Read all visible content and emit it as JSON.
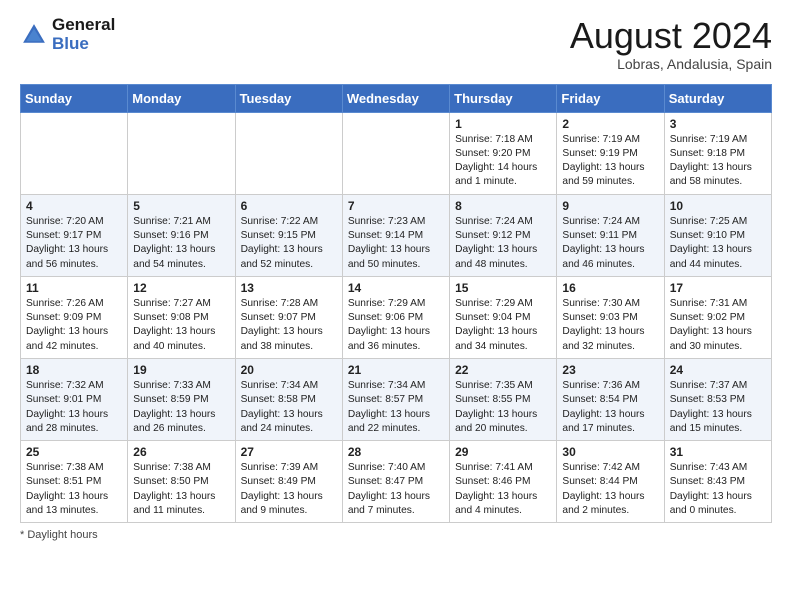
{
  "header": {
    "logo_line1": "General",
    "logo_line2": "Blue",
    "month_year": "August 2024",
    "location": "Lobras, Andalusia, Spain"
  },
  "days_of_week": [
    "Sunday",
    "Monday",
    "Tuesday",
    "Wednesday",
    "Thursday",
    "Friday",
    "Saturday"
  ],
  "weeks": [
    [
      {
        "day": "",
        "info": ""
      },
      {
        "day": "",
        "info": ""
      },
      {
        "day": "",
        "info": ""
      },
      {
        "day": "",
        "info": ""
      },
      {
        "day": "1",
        "info": "Sunrise: 7:18 AM\nSunset: 9:20 PM\nDaylight: 14 hours\nand 1 minute."
      },
      {
        "day": "2",
        "info": "Sunrise: 7:19 AM\nSunset: 9:19 PM\nDaylight: 13 hours\nand 59 minutes."
      },
      {
        "day": "3",
        "info": "Sunrise: 7:19 AM\nSunset: 9:18 PM\nDaylight: 13 hours\nand 58 minutes."
      }
    ],
    [
      {
        "day": "4",
        "info": "Sunrise: 7:20 AM\nSunset: 9:17 PM\nDaylight: 13 hours\nand 56 minutes."
      },
      {
        "day": "5",
        "info": "Sunrise: 7:21 AM\nSunset: 9:16 PM\nDaylight: 13 hours\nand 54 minutes."
      },
      {
        "day": "6",
        "info": "Sunrise: 7:22 AM\nSunset: 9:15 PM\nDaylight: 13 hours\nand 52 minutes."
      },
      {
        "day": "7",
        "info": "Sunrise: 7:23 AM\nSunset: 9:14 PM\nDaylight: 13 hours\nand 50 minutes."
      },
      {
        "day": "8",
        "info": "Sunrise: 7:24 AM\nSunset: 9:12 PM\nDaylight: 13 hours\nand 48 minutes."
      },
      {
        "day": "9",
        "info": "Sunrise: 7:24 AM\nSunset: 9:11 PM\nDaylight: 13 hours\nand 46 minutes."
      },
      {
        "day": "10",
        "info": "Sunrise: 7:25 AM\nSunset: 9:10 PM\nDaylight: 13 hours\nand 44 minutes."
      }
    ],
    [
      {
        "day": "11",
        "info": "Sunrise: 7:26 AM\nSunset: 9:09 PM\nDaylight: 13 hours\nand 42 minutes."
      },
      {
        "day": "12",
        "info": "Sunrise: 7:27 AM\nSunset: 9:08 PM\nDaylight: 13 hours\nand 40 minutes."
      },
      {
        "day": "13",
        "info": "Sunrise: 7:28 AM\nSunset: 9:07 PM\nDaylight: 13 hours\nand 38 minutes."
      },
      {
        "day": "14",
        "info": "Sunrise: 7:29 AM\nSunset: 9:06 PM\nDaylight: 13 hours\nand 36 minutes."
      },
      {
        "day": "15",
        "info": "Sunrise: 7:29 AM\nSunset: 9:04 PM\nDaylight: 13 hours\nand 34 minutes."
      },
      {
        "day": "16",
        "info": "Sunrise: 7:30 AM\nSunset: 9:03 PM\nDaylight: 13 hours\nand 32 minutes."
      },
      {
        "day": "17",
        "info": "Sunrise: 7:31 AM\nSunset: 9:02 PM\nDaylight: 13 hours\nand 30 minutes."
      }
    ],
    [
      {
        "day": "18",
        "info": "Sunrise: 7:32 AM\nSunset: 9:01 PM\nDaylight: 13 hours\nand 28 minutes."
      },
      {
        "day": "19",
        "info": "Sunrise: 7:33 AM\nSunset: 8:59 PM\nDaylight: 13 hours\nand 26 minutes."
      },
      {
        "day": "20",
        "info": "Sunrise: 7:34 AM\nSunset: 8:58 PM\nDaylight: 13 hours\nand 24 minutes."
      },
      {
        "day": "21",
        "info": "Sunrise: 7:34 AM\nSunset: 8:57 PM\nDaylight: 13 hours\nand 22 minutes."
      },
      {
        "day": "22",
        "info": "Sunrise: 7:35 AM\nSunset: 8:55 PM\nDaylight: 13 hours\nand 20 minutes."
      },
      {
        "day": "23",
        "info": "Sunrise: 7:36 AM\nSunset: 8:54 PM\nDaylight: 13 hours\nand 17 minutes."
      },
      {
        "day": "24",
        "info": "Sunrise: 7:37 AM\nSunset: 8:53 PM\nDaylight: 13 hours\nand 15 minutes."
      }
    ],
    [
      {
        "day": "25",
        "info": "Sunrise: 7:38 AM\nSunset: 8:51 PM\nDaylight: 13 hours\nand 13 minutes."
      },
      {
        "day": "26",
        "info": "Sunrise: 7:38 AM\nSunset: 8:50 PM\nDaylight: 13 hours\nand 11 minutes."
      },
      {
        "day": "27",
        "info": "Sunrise: 7:39 AM\nSunset: 8:49 PM\nDaylight: 13 hours\nand 9 minutes."
      },
      {
        "day": "28",
        "info": "Sunrise: 7:40 AM\nSunset: 8:47 PM\nDaylight: 13 hours\nand 7 minutes."
      },
      {
        "day": "29",
        "info": "Sunrise: 7:41 AM\nSunset: 8:46 PM\nDaylight: 13 hours\nand 4 minutes."
      },
      {
        "day": "30",
        "info": "Sunrise: 7:42 AM\nSunset: 8:44 PM\nDaylight: 13 hours\nand 2 minutes."
      },
      {
        "day": "31",
        "info": "Sunrise: 7:43 AM\nSunset: 8:43 PM\nDaylight: 13 hours\nand 0 minutes."
      }
    ]
  ],
  "footer": {
    "note": "Daylight hours"
  }
}
